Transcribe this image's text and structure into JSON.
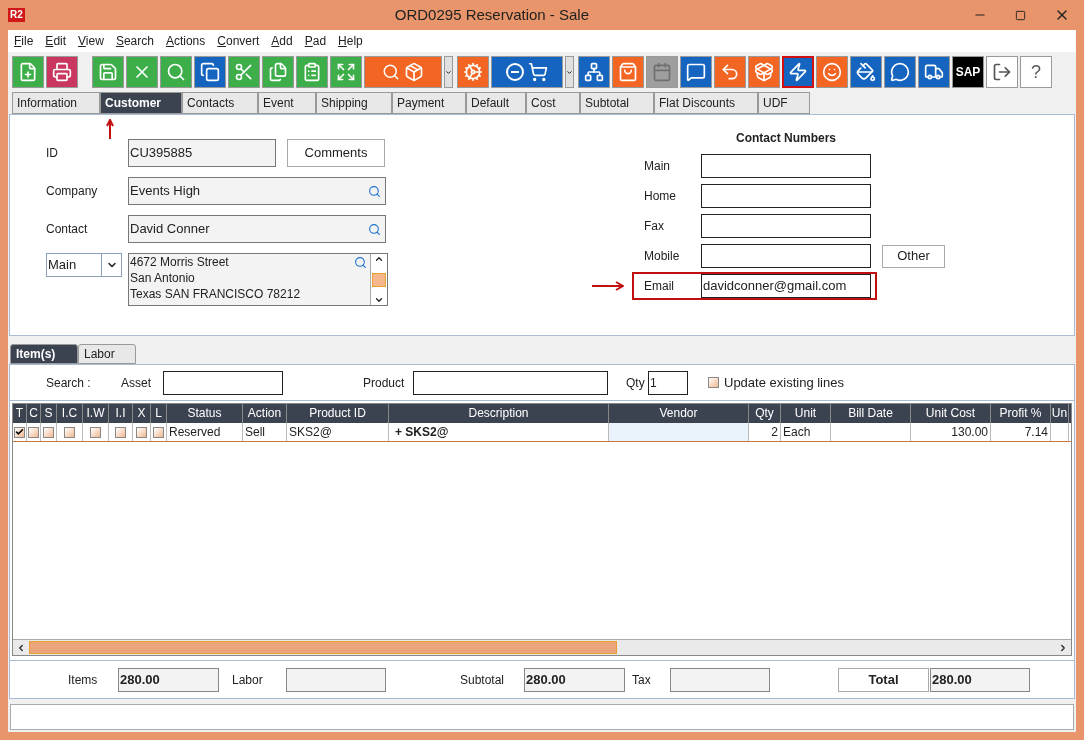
{
  "window": {
    "title": "ORD0295 Reservation - Sale",
    "logo": "R2"
  },
  "menu": [
    "File",
    "Edit",
    "View",
    "Search",
    "Actions",
    "Convert",
    "Add",
    "Pad",
    "Help"
  ],
  "toolbar": [
    {
      "kind": "icon",
      "color": "#3dae49",
      "selected": false,
      "disabled": false
    },
    {
      "kind": "icon",
      "color": "#c9365f",
      "selected": false,
      "disabled": false
    },
    {
      "kind": "icon",
      "color": "#3dae49",
      "selected": false,
      "disabled": false
    },
    {
      "kind": "icon",
      "color": "#3dae49",
      "selected": false,
      "disabled": false
    },
    {
      "kind": "icon",
      "color": "#3dae49",
      "selected": false,
      "disabled": false
    },
    {
      "kind": "icon",
      "color": "#1565c0",
      "selected": false,
      "disabled": false
    },
    {
      "kind": "icon",
      "color": "#3dae49",
      "selected": false,
      "disabled": false
    },
    {
      "kind": "icon",
      "color": "#3dae49",
      "selected": false,
      "disabled": false
    },
    {
      "kind": "icon",
      "color": "#3dae49",
      "selected": false,
      "disabled": false
    },
    {
      "kind": "icon",
      "color": "#3dae49",
      "selected": false,
      "disabled": false
    },
    {
      "kind": "wide",
      "color": "#f26522",
      "selected": false,
      "disabled": false
    },
    {
      "kind": "dropdown",
      "color": "#e0e0e0",
      "selected": false,
      "disabled": false
    },
    {
      "kind": "icon",
      "color": "#f26522",
      "selected": false,
      "disabled": false
    },
    {
      "kind": "wide",
      "color": "#1565c0",
      "selected": false,
      "disabled": false
    },
    {
      "kind": "dropdown",
      "color": "#e0e0e0",
      "selected": false,
      "disabled": false
    },
    {
      "kind": "icon",
      "color": "#1565c0",
      "selected": false,
      "disabled": false
    },
    {
      "kind": "icon",
      "color": "#f26522",
      "selected": false,
      "disabled": false
    },
    {
      "kind": "icon",
      "color": "#9e9e9e",
      "selected": false,
      "disabled": true
    },
    {
      "kind": "icon",
      "color": "#1565c0",
      "selected": false,
      "disabled": false
    },
    {
      "kind": "icon",
      "color": "#f26522",
      "selected": false,
      "disabled": false
    },
    {
      "kind": "icon",
      "color": "#f26522",
      "selected": false,
      "disabled": false
    },
    {
      "kind": "icon",
      "color": "#1565c0",
      "selected": true,
      "disabled": false
    },
    {
      "kind": "icon",
      "color": "#f26522",
      "selected": false,
      "disabled": false
    },
    {
      "kind": "icon",
      "color": "#1565c0",
      "selected": false,
      "disabled": false
    },
    {
      "kind": "icon",
      "color": "#1565c0",
      "selected": false,
      "disabled": false
    },
    {
      "kind": "icon",
      "color": "#1565c0",
      "selected": false,
      "disabled": false
    },
    {
      "kind": "text",
      "label": "SAP",
      "color": "#000000",
      "selected": false,
      "disabled": false
    },
    {
      "kind": "icon",
      "color": "#ffffff",
      "selected": false,
      "disabled": false
    },
    {
      "kind": "text",
      "label": "?",
      "color": "#ffffff",
      "selected": false,
      "disabled": false
    }
  ],
  "tabs": [
    {
      "label": "Information",
      "selected": false
    },
    {
      "label": "Customer",
      "selected": true
    },
    {
      "label": "Contacts",
      "selected": false
    },
    {
      "label": "Event",
      "selected": false
    },
    {
      "label": "Shipping",
      "selected": false
    },
    {
      "label": "Payment",
      "selected": false
    },
    {
      "label": "Default",
      "selected": false
    },
    {
      "label": "Cost",
      "selected": false
    },
    {
      "label": "Subtotal",
      "selected": false
    },
    {
      "label": "Flat Discounts",
      "selected": false
    },
    {
      "label": "UDF",
      "selected": false
    }
  ],
  "customer": {
    "fields": [
      {
        "label": "ID",
        "value": "CU395885",
        "kind": "plain"
      },
      {
        "label": "Company",
        "value": "Events High",
        "kind": "lookup"
      },
      {
        "label": "Contact",
        "value": "David Conner",
        "kind": "lookup"
      }
    ],
    "comments_button": "Comments",
    "address_type": "Main",
    "address_lines": [
      "4672 Morris Street",
      "San Antonio",
      "Texas SAN FRANCISCO 78212"
    ]
  },
  "contact_numbers": {
    "title": "Contact Numbers",
    "fields": [
      {
        "label": "Main",
        "highlighted": false
      },
      {
        "label": "Home",
        "highlighted": false
      },
      {
        "label": "Fax",
        "highlighted": false
      },
      {
        "label": "Mobile",
        "highlighted": false
      },
      {
        "label": "Email",
        "value": "davidconner@gmail.com",
        "highlighted": true
      }
    ],
    "other_button": "Other"
  },
  "item_tabs": [
    {
      "label": "Item(s)",
      "selected": true
    },
    {
      "label": "Labor",
      "selected": false
    }
  ],
  "search": {
    "label": "Search :",
    "asset_label": "Asset",
    "product_label": "Product",
    "qty_label": "Qty",
    "qty_value": "1",
    "update_label": "Update existing lines",
    "update_checked": false
  },
  "table": {
    "columns": [
      "T",
      "C",
      "S",
      "I.C",
      "I.W",
      "I.I",
      "X",
      "L",
      "Status",
      "Action",
      "Product ID",
      "Description",
      "Vendor",
      "Qty",
      "Unit",
      "Bill Date",
      "Unit Cost",
      "Profit %",
      "Un"
    ],
    "rows": [
      {
        "flags": [
          true,
          false,
          false,
          false,
          false,
          false,
          false,
          false
        ],
        "status": "Reserved",
        "action": "Sell",
        "product_id": "SKS2@",
        "description": "+ SKS2@",
        "qty": "2",
        "unit": "Each",
        "unit_cost": "130.00",
        "profit": "7.14"
      }
    ]
  },
  "totals": {
    "items_label": "Items",
    "items": "280.00",
    "labor_label": "Labor",
    "subtotal_label": "Subtotal",
    "subtotal": "280.00",
    "tax_label": "Tax",
    "total_button": "Total",
    "total": "280.00"
  }
}
